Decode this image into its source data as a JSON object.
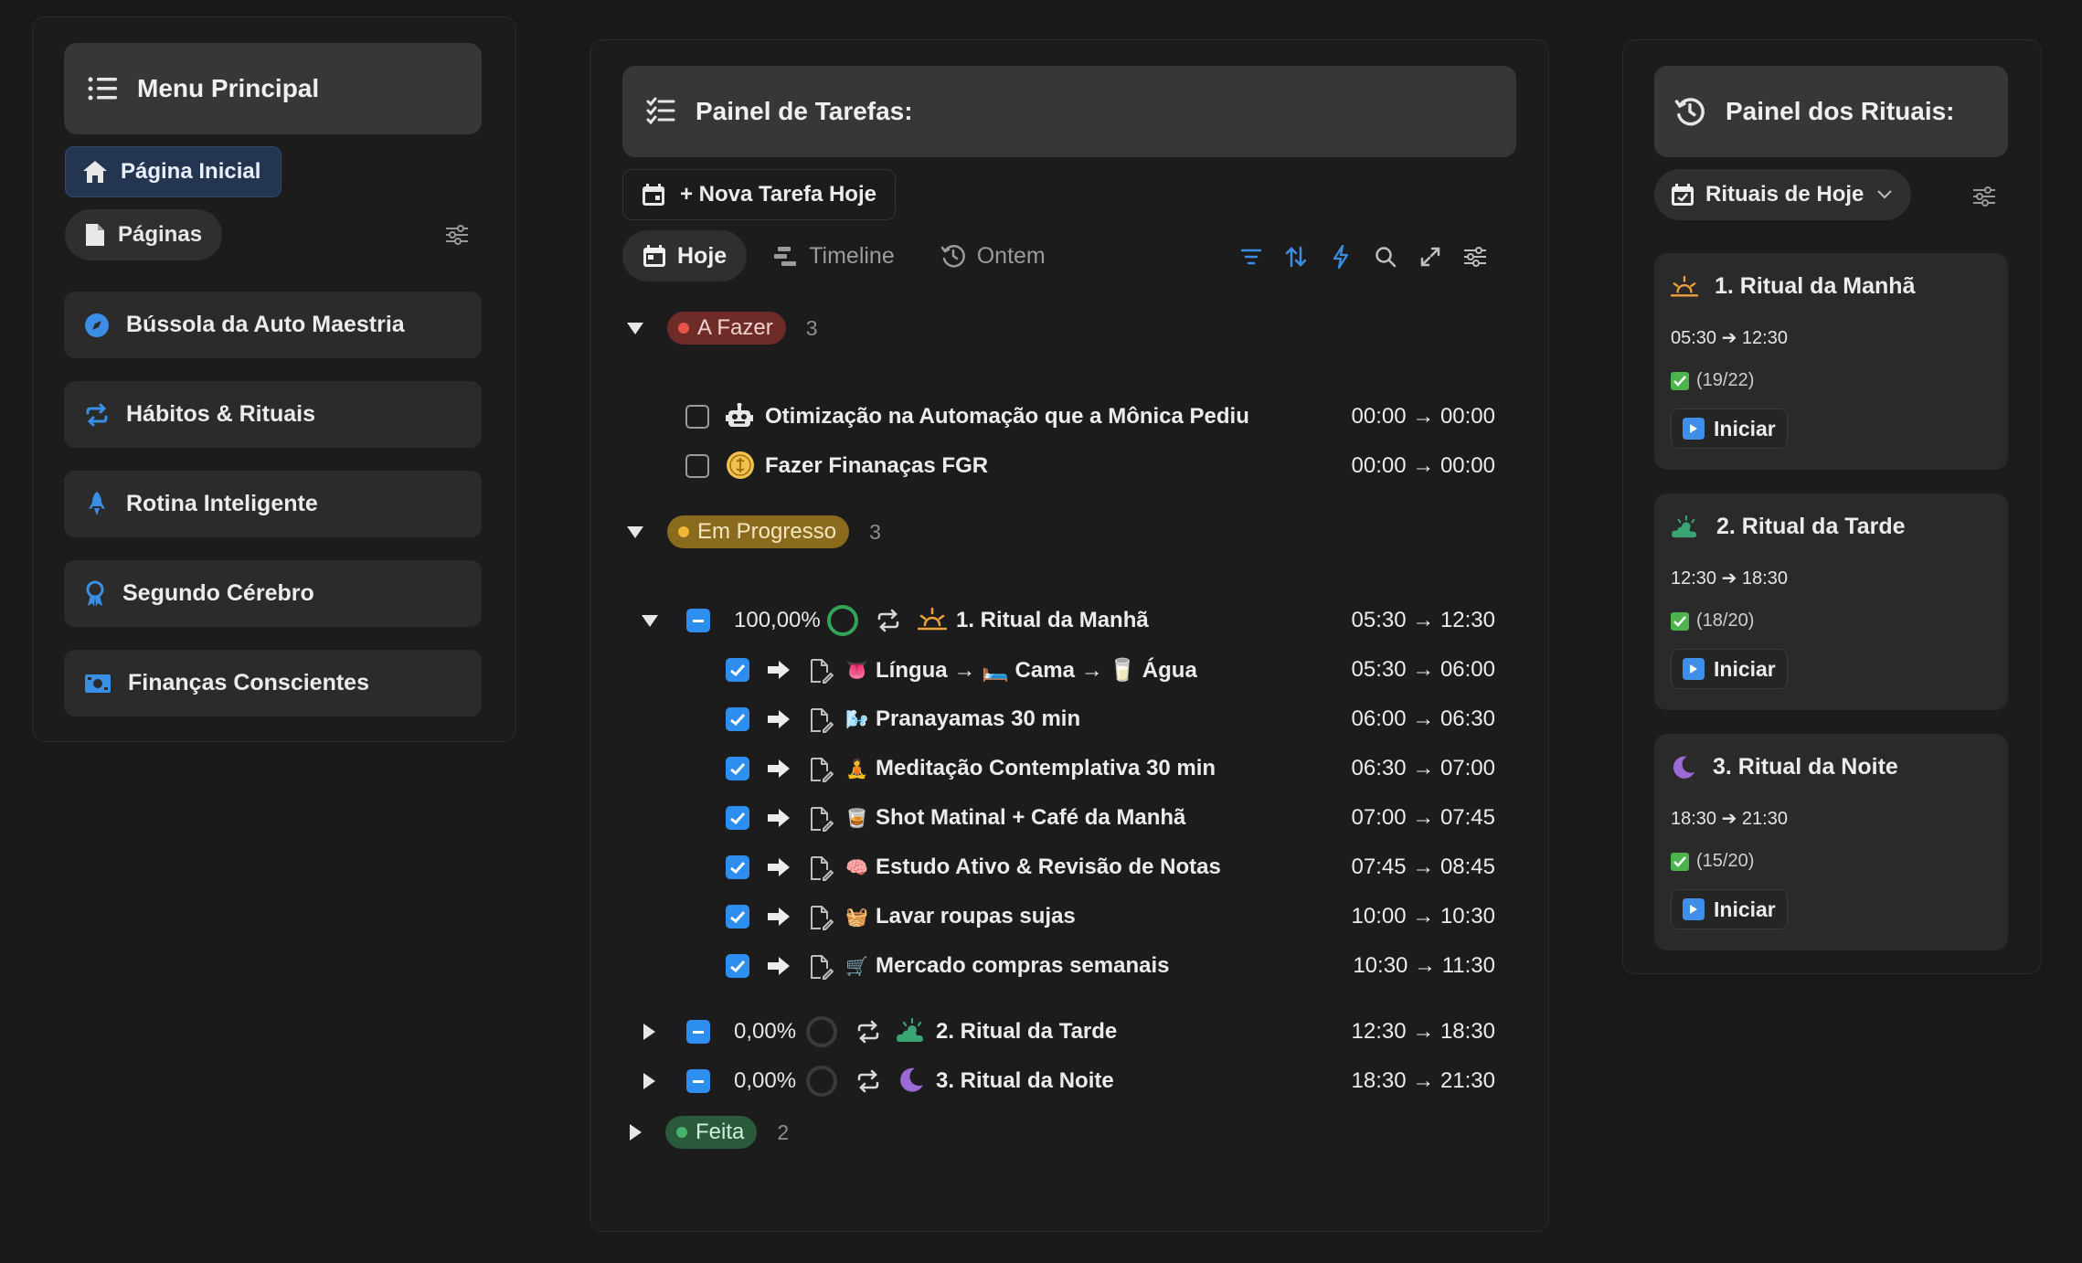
{
  "left": {
    "menu_title": "Menu Principal",
    "home_label": "Página Inicial",
    "pages_label": "Páginas",
    "nav_items": [
      {
        "label": "Bússola da Auto Maestria"
      },
      {
        "label": "Hábitos & Rituais"
      },
      {
        "label": "Rotina Inteligente"
      },
      {
        "label": "Segundo Cérebro"
      },
      {
        "label": "Finanças Conscientes"
      }
    ]
  },
  "tasks": {
    "title": "Painel de Tarefas:",
    "new_task_label": "+ Nova Tarefa Hoje",
    "tabs": [
      {
        "label": "Hoje"
      },
      {
        "label": "Timeline"
      },
      {
        "label": "Ontem"
      }
    ],
    "groups": {
      "todo": {
        "label": "A Fazer",
        "count": "3"
      },
      "progress": {
        "label": "Em Progresso",
        "count": "3"
      },
      "done": {
        "label": "Feita",
        "count": "2"
      }
    },
    "todo_items": [
      {
        "title": "Otimização na Automação que a Mônica Pediu",
        "time": "00:00 → 00:00"
      },
      {
        "title": "Fazer Finanaças FGR",
        "time": "00:00 → 00:00"
      }
    ],
    "ritual_rows": [
      {
        "pct": "100,00%",
        "title": "1. Ritual da Manhã",
        "time": "05:30 → 12:30"
      },
      {
        "pct": "0,00%",
        "title": "2. Ritual da Tarde",
        "time": "12:30 → 18:30"
      },
      {
        "pct": "0,00%",
        "title": "3. Ritual da Noite",
        "time": "18:30 → 21:30"
      }
    ],
    "subtasks": [
      {
        "emoji": "👅",
        "title": "Língua → 🛏️ Cama → 🥛 Água",
        "time": "05:30 → 06:00"
      },
      {
        "emoji": "🌬️",
        "title": "Pranayamas 30 min",
        "time": "06:00 → 06:30"
      },
      {
        "emoji": "🧘",
        "title": "Meditação Contemplativa 30 min",
        "time": "06:30 → 07:00"
      },
      {
        "emoji": "🥃",
        "title": "Shot Matinal + Café da Manhã",
        "time": "07:00 → 07:45"
      },
      {
        "emoji": "🧠",
        "title": "Estudo Ativo & Revisão de Notas",
        "time": "07:45 → 08:45"
      },
      {
        "emoji": "🧺",
        "title": "Lavar roupas sujas",
        "time": "10:00 → 10:30"
      },
      {
        "emoji": "🛒",
        "title": "Mercado compras semanais",
        "time": "10:30 → 11:30"
      }
    ]
  },
  "rituals": {
    "title": "Painel dos Rituais:",
    "filter_label": "Rituais de Hoje",
    "cards": [
      {
        "title": "1. Ritual da Manhã",
        "time": "05:30 ➔ 12:30",
        "progress": "(19/22)",
        "button": "Iniciar"
      },
      {
        "title": "2. Ritual da Tarde",
        "time": "12:30 ➔ 18:30",
        "progress": "(18/20)",
        "button": "Iniciar"
      },
      {
        "title": "3. Ritual da Noite",
        "time": "18:30 ➔ 21:30",
        "progress": "(15/20)",
        "button": "Iniciar"
      }
    ]
  },
  "colors": {
    "accent_blue": "#2d8ef0",
    "todo_badge": "#6e2b28",
    "progress_badge": "#8a6a1c",
    "done_badge": "#2a5a3a"
  }
}
